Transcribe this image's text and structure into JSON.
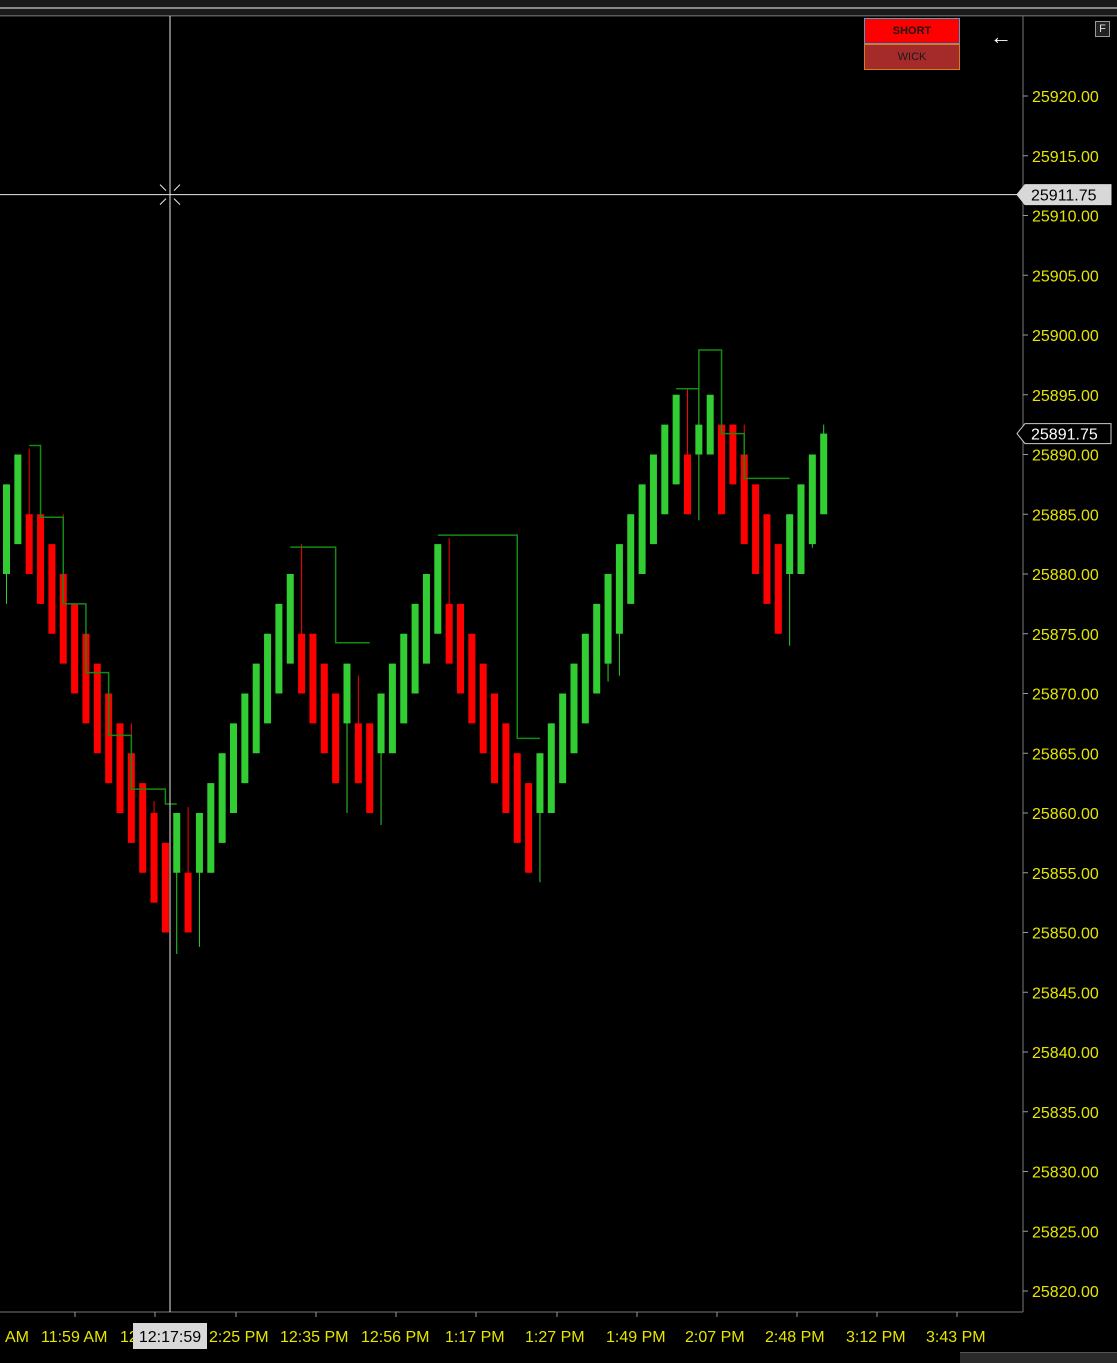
{
  "toolbar": {
    "short_label": "SHORT",
    "wick_label": "WICK",
    "back_icon": "arrow-left-icon",
    "f_label": "F"
  },
  "crosshair": {
    "price_label": "25911.75",
    "time_label": "12:17:59"
  },
  "last_price_label": "25891.75",
  "colors": {
    "up": "#32cd32",
    "down": "#ff0000",
    "trail": "#138a13",
    "axis_text": "#e6e600",
    "background": "#000000"
  },
  "chart_data": {
    "type": "candlestick",
    "ylim": [
      25817.5,
      25925
    ],
    "y_ticks": [
      "25920.00",
      "25915.00",
      "25910.00",
      "25905.00",
      "25900.00",
      "25895.00",
      "25890.00",
      "25885.00",
      "25880.00",
      "25875.00",
      "25870.00",
      "25865.00",
      "25860.00",
      "25855.00",
      "25850.00",
      "25845.00",
      "25840.00",
      "25835.00",
      "25830.00",
      "25825.00",
      "25820.00"
    ],
    "x_ticks": [
      "AM",
      "11:59 AM",
      "12",
      "2:25 PM",
      "12:35 PM",
      "12:56 PM",
      "1:17 PM",
      "1:27 PM",
      "1:49 PM",
      "2:07 PM",
      "2:48 PM",
      "3:12 PM",
      "3:43 PM"
    ],
    "candles": [
      {
        "o": 25880,
        "c": 25887.5,
        "h": 25887.5,
        "l": 25877.5
      },
      {
        "o": 25882.5,
        "c": 25890,
        "h": 25890,
        "l": 25882.5
      },
      {
        "o": 25885,
        "c": 25880,
        "h": 25890.5,
        "l": 25880
      },
      {
        "o": 25885,
        "c": 25877.5,
        "h": 25885,
        "l": 25877.5
      },
      {
        "o": 25882.5,
        "c": 25875,
        "h": 25882.5,
        "l": 25875
      },
      {
        "o": 25880,
        "c": 25872.5,
        "h": 25885,
        "l": 25872.5
      },
      {
        "o": 25877.5,
        "c": 25870,
        "h": 25877.5,
        "l": 25870
      },
      {
        "o": 25875,
        "c": 25867.5,
        "h": 25877.5,
        "l": 25867.5
      },
      {
        "o": 25872.5,
        "c": 25865,
        "h": 25872.5,
        "l": 25865
      },
      {
        "o": 25870,
        "c": 25862.5,
        "h": 25870,
        "l": 25862.5
      },
      {
        "o": 25867.5,
        "c": 25860,
        "h": 25867.5,
        "l": 25860
      },
      {
        "o": 25865,
        "c": 25857.5,
        "h": 25867.5,
        "l": 25857.5
      },
      {
        "o": 25862.5,
        "c": 25855,
        "h": 25862.5,
        "l": 25855
      },
      {
        "o": 25860,
        "c": 25852.5,
        "h": 25861,
        "l": 25852.5
      },
      {
        "o": 25857.5,
        "c": 25850,
        "h": 25857.5,
        "l": 25850
      },
      {
        "o": 25855,
        "c": 25860,
        "h": 25860,
        "l": 25848.2
      },
      {
        "o": 25855,
        "c": 25850,
        "h": 25860.5,
        "l": 25850
      },
      {
        "o": 25855,
        "c": 25860,
        "h": 25860,
        "l": 25848.8
      },
      {
        "o": 25855,
        "c": 25862.5,
        "h": 25862.5,
        "l": 25855
      },
      {
        "o": 25857.5,
        "c": 25865,
        "h": 25865,
        "l": 25857.5
      },
      {
        "o": 25860,
        "c": 25867.5,
        "h": 25867.5,
        "l": 25860
      },
      {
        "o": 25862.5,
        "c": 25870,
        "h": 25870,
        "l": 25862.5
      },
      {
        "o": 25865,
        "c": 25872.5,
        "h": 25872.5,
        "l": 25865
      },
      {
        "o": 25867.5,
        "c": 25875,
        "h": 25875,
        "l": 25867.5
      },
      {
        "o": 25870,
        "c": 25877.5,
        "h": 25877.5,
        "l": 25870
      },
      {
        "o": 25872.5,
        "c": 25880,
        "h": 25880,
        "l": 25872.5
      },
      {
        "o": 25875,
        "c": 25870,
        "h": 25882.5,
        "l": 25870
      },
      {
        "o": 25875,
        "c": 25867.5,
        "h": 25875,
        "l": 25867.5
      },
      {
        "o": 25872.5,
        "c": 25865,
        "h": 25872.5,
        "l": 25865
      },
      {
        "o": 25870,
        "c": 25862.5,
        "h": 25870,
        "l": 25862.5
      },
      {
        "o": 25867.5,
        "c": 25872.5,
        "h": 25872.5,
        "l": 25860
      },
      {
        "o": 25867.5,
        "c": 25862.5,
        "h": 25871.5,
        "l": 25862.5
      },
      {
        "o": 25867.5,
        "c": 25860,
        "h": 25867.5,
        "l": 25860
      },
      {
        "o": 25865,
        "c": 25870,
        "h": 25870,
        "l": 25859
      },
      {
        "o": 25865,
        "c": 25872.5,
        "h": 25872.5,
        "l": 25865
      },
      {
        "o": 25867.5,
        "c": 25875,
        "h": 25875,
        "l": 25867.5
      },
      {
        "o": 25870,
        "c": 25877.5,
        "h": 25877.5,
        "l": 25870
      },
      {
        "o": 25872.5,
        "c": 25880,
        "h": 25880,
        "l": 25872.5
      },
      {
        "o": 25875,
        "c": 25882.5,
        "h": 25882.5,
        "l": 25875
      },
      {
        "o": 25877.5,
        "c": 25872.5,
        "h": 25883,
        "l": 25872.5
      },
      {
        "o": 25877.5,
        "c": 25870,
        "h": 25877.5,
        "l": 25870
      },
      {
        "o": 25875,
        "c": 25867.5,
        "h": 25875,
        "l": 25867.5
      },
      {
        "o": 25872.5,
        "c": 25865,
        "h": 25872.5,
        "l": 25865
      },
      {
        "o": 25870,
        "c": 25862.5,
        "h": 25870,
        "l": 25862.5
      },
      {
        "o": 25867.5,
        "c": 25860,
        "h": 25867.5,
        "l": 25860
      },
      {
        "o": 25865,
        "c": 25857.5,
        "h": 25865,
        "l": 25857.5
      },
      {
        "o": 25862.5,
        "c": 25855,
        "h": 25862.5,
        "l": 25855
      },
      {
        "o": 25860,
        "c": 25865,
        "h": 25865,
        "l": 25854.2
      },
      {
        "o": 25860,
        "c": 25867.5,
        "h": 25867.5,
        "l": 25860
      },
      {
        "o": 25862.5,
        "c": 25870,
        "h": 25870,
        "l": 25862.5
      },
      {
        "o": 25865,
        "c": 25872.5,
        "h": 25872.5,
        "l": 25865
      },
      {
        "o": 25867.5,
        "c": 25875,
        "h": 25875,
        "l": 25867.5
      },
      {
        "o": 25870,
        "c": 25877.5,
        "h": 25877.5,
        "l": 25870
      },
      {
        "o": 25872.5,
        "c": 25880,
        "h": 25880,
        "l": 25871
      },
      {
        "o": 25875,
        "c": 25882.5,
        "h": 25882.5,
        "l": 25871.5
      },
      {
        "o": 25877.5,
        "c": 25885,
        "h": 25885,
        "l": 25877.5
      },
      {
        "o": 25880,
        "c": 25887.5,
        "h": 25887.5,
        "l": 25880
      },
      {
        "o": 25882.5,
        "c": 25890,
        "h": 25890,
        "l": 25882.5
      },
      {
        "o": 25885,
        "c": 25892.5,
        "h": 25892.5,
        "l": 25885
      },
      {
        "o": 25887.5,
        "c": 25895,
        "h": 25895,
        "l": 25887.5
      },
      {
        "o": 25890,
        "c": 25885,
        "h": 25895.5,
        "l": 25885
      },
      {
        "o": 25890,
        "c": 25892.5,
        "h": 25895.5,
        "l": 25884.5
      },
      {
        "o": 25890,
        "c": 25895,
        "h": 25895,
        "l": 25890
      },
      {
        "o": 25892.5,
        "c": 25885,
        "h": 25898.5,
        "l": 25885
      },
      {
        "o": 25892.5,
        "c": 25887.5,
        "h": 25892.5,
        "l": 25887.5
      },
      {
        "o": 25890,
        "c": 25882.5,
        "h": 25892.5,
        "l": 25882.5
      },
      {
        "o": 25887.5,
        "c": 25880,
        "h": 25887.5,
        "l": 25880
      },
      {
        "o": 25885,
        "c": 25877.5,
        "h": 25885,
        "l": 25877.5
      },
      {
        "o": 25882.5,
        "c": 25875,
        "h": 25882.5,
        "l": 25875
      },
      {
        "o": 25880,
        "c": 25885,
        "h": 25885,
        "l": 25874
      },
      {
        "o": 25880,
        "c": 25887.5,
        "h": 25887.5,
        "l": 25880
      },
      {
        "o": 25882.5,
        "c": 25890,
        "h": 25890,
        "l": 25882.2
      },
      {
        "o": 25885,
        "c": 25891.75,
        "h": 25892.5,
        "l": 25885
      }
    ],
    "trail_line": [
      {
        "from": 2,
        "to": 3,
        "y": 25890.75
      },
      {
        "from": 3,
        "to": 5,
        "y": 25884.75
      },
      {
        "from": 5,
        "to": 7,
        "y": 25877.5
      },
      {
        "from": 7,
        "to": 9,
        "y": 25871.75
      },
      {
        "from": 9,
        "to": 11,
        "y": 25866.5
      },
      {
        "from": 11,
        "to": 14,
        "y": 25862
      },
      {
        "from": 14,
        "to": 15,
        "y": 25860.75
      },
      {
        "from": 25,
        "to": 29,
        "y": 25882.25
      },
      {
        "from": 29,
        "to": 32,
        "y": 25874.25
      },
      {
        "from": 38,
        "to": 45,
        "y": 25883.25
      },
      {
        "from": 45,
        "to": 47,
        "y": 25866.25
      },
      {
        "from": 59,
        "to": 61,
        "y": 25895.5
      },
      {
        "from": 61,
        "to": 63,
        "y": 25898.75
      },
      {
        "from": 63,
        "to": 65,
        "y": 25891.75
      },
      {
        "from": 65,
        "to": 69,
        "y": 25888
      }
    ]
  }
}
